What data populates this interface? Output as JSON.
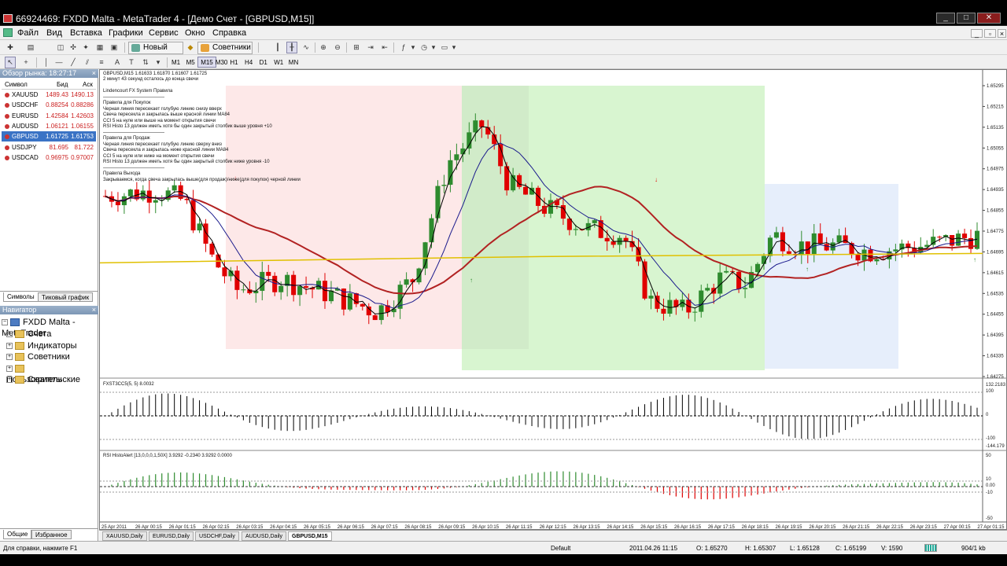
{
  "window": {
    "title": "66924469: FXDD Malta - MetaTrader 4 - [Демо Счет - [GBPUSD,M15]]"
  },
  "menu": [
    "Файл",
    "Вид",
    "Вставка",
    "Графики",
    "Сервис",
    "Окно",
    "Справка"
  ],
  "toolbar": {
    "new_order": "Новый Ордер",
    "experts": "Советники"
  },
  "timeframes": [
    "M1",
    "M5",
    "M15",
    "M30",
    "H1",
    "H4",
    "D1",
    "W1",
    "MN"
  ],
  "active_timeframe": "M15",
  "market_watch": {
    "title": "Обзор рынка: 18:27:17",
    "col_symbol": "Символ",
    "col_bid": "Бид",
    "col_ask": "Аск",
    "rows": [
      {
        "symbol": "XAUUSD",
        "bid": "1489.43",
        "ask": "1490.13",
        "selected": false
      },
      {
        "symbol": "USDCHF",
        "bid": "0.88254",
        "ask": "0.88286",
        "selected": false
      },
      {
        "symbol": "EURUSD",
        "bid": "1.42584",
        "ask": "1.42603",
        "selected": false
      },
      {
        "symbol": "AUDUSD",
        "bid": "1.06121",
        "ask": "1.06155",
        "selected": false
      },
      {
        "symbol": "GBPUSD",
        "bid": "1.61725",
        "ask": "1.61753",
        "selected": true
      },
      {
        "symbol": "USDJPY",
        "bid": "81.695",
        "ask": "81.722",
        "selected": false
      },
      {
        "symbol": "USDCAD",
        "bid": "0.96975",
        "ask": "0.97007",
        "selected": false
      }
    ],
    "tabs": [
      "Символы",
      "Тиковый график"
    ]
  },
  "navigator": {
    "title": "Навигатор",
    "root": "FXDD Malta - MetaTrader",
    "items": [
      "Счета",
      "Индикаторы",
      "Советники",
      "Пользовательские",
      "Скрипты"
    ],
    "tabs": [
      "Общие",
      "Избранное"
    ]
  },
  "chart": {
    "header": "GBPUSD,M15  1.61633 1.61870 1.61607 1.61725",
    "countdown": "2 минут 43 секунд осталось до конца свечи",
    "notes": [
      "Lindencourt FX System Правила",
      "—————————————",
      "Правила для Покупок",
      "Черная линия пересекает голубую линию снизу вверх",
      "Свеча пересекла и закрылась выше красной линии MA84",
      "CCI 5 на нуле или выше на момент открытия свечи",
      "RSI Histo 13 должен иметь хотя бы один закрытый столбик выше уровня +10",
      "—————————————",
      "Правила для Продаж",
      "Черная линия пересекает голубую линию сверху вниз",
      "Свеча пересекла и закрылась ниже красной линии MA84",
      "CCI 5 на нуле или ниже на момент открытия свечи",
      "RSI Histo 13 должен иметь хотя бы один закрытый столбик ниже уровня -10",
      "—————————————",
      "Правила Выхода",
      "Закрываемся, когда свеча закрылась выше(для продаж)/ниже(для покупок) черной линии"
    ],
    "price_labels": [
      "1.65295",
      "1.65215",
      "1.65135",
      "1.65055",
      "1.64975",
      "1.64935",
      "1.64855",
      "1.64775",
      "1.64695",
      "1.64615",
      "1.64535",
      "1.64455",
      "1.64395",
      "1.64335",
      "1.64275"
    ],
    "cci_label": "FXST3CC5(5, 5) 8.0032",
    "cci_scale": [
      "132.2183",
      "100",
      "0",
      "-100",
      "-144.179"
    ],
    "rsi_label": "RSI HistoAlert [13,0,0,0,1,50X] 3.9292 -0.2340 3.9292 0.0000",
    "rsi_scale": [
      "50",
      "10",
      "0.00",
      "-10",
      "-50"
    ],
    "time_labels": [
      "25 Apr 2011",
      "26 Apr 00:15",
      "26 Apr 01:15",
      "26 Apr 02:15",
      "26 Apr 03:15",
      "26 Apr 04:15",
      "26 Apr 05:15",
      "26 Apr 06:15",
      "26 Apr 07:15",
      "26 Apr 08:15",
      "26 Apr 09:15",
      "26 Apr 10:15",
      "26 Apr 11:15",
      "26 Apr 12:15",
      "26 Apr 13:15",
      "26 Apr 14:15",
      "26 Apr 15:15",
      "26 Apr 16:15",
      "26 Apr 17:15",
      "26 Apr 18:15",
      "26 Apr 19:15",
      "26 Apr 20:15",
      "26 Apr 21:15",
      "26 Apr 22:15",
      "26 Apr 23:15",
      "27 Apr 00:15",
      "27 Apr 01:15"
    ],
    "colors": {
      "bull": "#2e8b2e",
      "bear": "#e00000",
      "ma84": "#b22222",
      "fast": "#000000",
      "slow": "#1a1a8c",
      "level": "#e0c000",
      "buy_zone": "#d8f5d0",
      "sell_zone": "#fde8e8",
      "neutral_zone": "#e6eefb"
    }
  },
  "chart_tabs": [
    {
      "label": "XAUUSD,Daily",
      "active": false
    },
    {
      "label": "EURUSD,Daily",
      "active": false
    },
    {
      "label": "USDCHF,Daily",
      "active": false
    },
    {
      "label": "AUDUSD,Daily",
      "active": false
    },
    {
      "label": "GBPUSD,M15",
      "active": true
    }
  ],
  "status": {
    "help": "Для справки, нажмите F1",
    "profile": "Default",
    "datetime": "2011.04.26 11:15",
    "open": "O: 1.65270",
    "high": "H: 1.65307",
    "low": "L: 1.65128",
    "close": "C: 1.65199",
    "volume": "V: 1590",
    "traffic": "904/1 kb"
  }
}
